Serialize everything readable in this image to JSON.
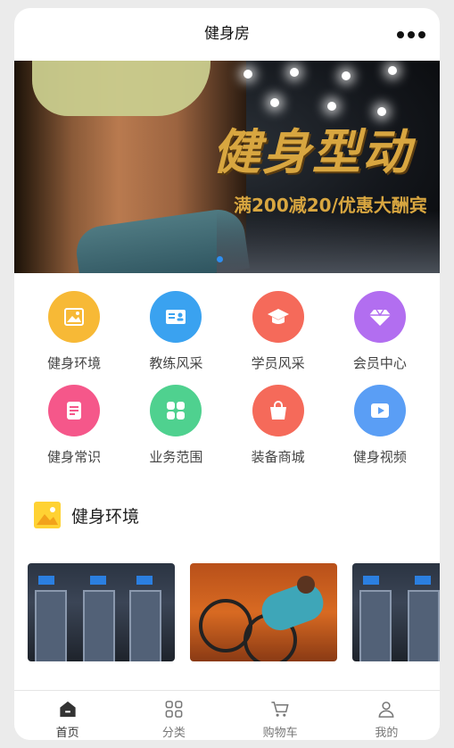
{
  "header": {
    "title": "健身房",
    "more_icon": "more-dots-icon"
  },
  "banner": {
    "headline": "健身型动",
    "promo": "满200减20/优惠大酬宾",
    "indicator_color": "#2e8ef0"
  },
  "categories": [
    {
      "label": "健身环境",
      "icon": "picture-icon",
      "color": "#f7b936"
    },
    {
      "label": "教练风采",
      "icon": "id-card-icon",
      "color": "#3aa2f0"
    },
    {
      "label": "学员风采",
      "icon": "graduation-cap-icon",
      "color": "#f56a5a"
    },
    {
      "label": "会员中心",
      "icon": "diamond-icon",
      "color": "#b26ef0"
    },
    {
      "label": "健身常识",
      "icon": "document-icon",
      "color": "#f5578a"
    },
    {
      "label": "业务范围",
      "icon": "grid-icon",
      "color": "#4fd18f"
    },
    {
      "label": "装备商城",
      "icon": "shopping-bag-icon",
      "color": "#f56a5a"
    },
    {
      "label": "健身视频",
      "icon": "video-icon",
      "color": "#5a9ef5"
    }
  ],
  "section": {
    "title": "健身环境",
    "icon": "picture-icon",
    "icon_color": "#ffd233"
  },
  "tabbar": [
    {
      "label": "首页",
      "icon": "home-icon",
      "active": true
    },
    {
      "label": "分类",
      "icon": "category-icon",
      "active": false
    },
    {
      "label": "购物车",
      "icon": "cart-icon",
      "active": false
    },
    {
      "label": "我的",
      "icon": "user-icon",
      "active": false
    }
  ]
}
